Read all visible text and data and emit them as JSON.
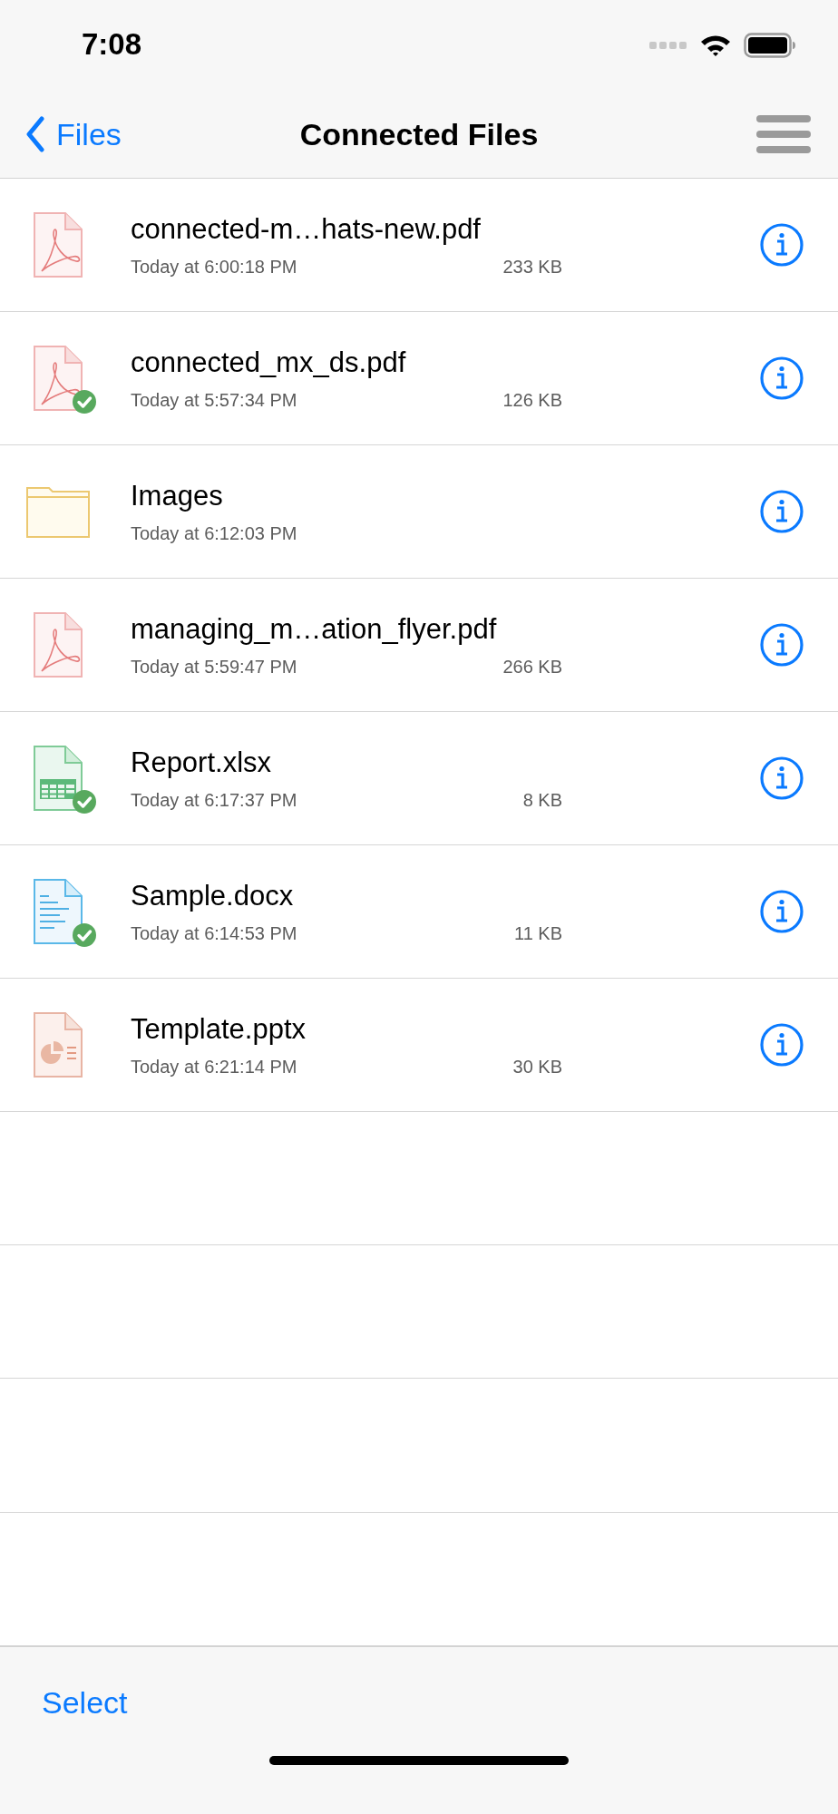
{
  "status_bar": {
    "time": "7:08"
  },
  "nav": {
    "back_label": "Files",
    "title": "Connected Files"
  },
  "files": [
    {
      "kind": "pdf",
      "name": "connected-m…hats-new.pdf",
      "modified": "Today at 6:00:18 PM",
      "size": "233 KB",
      "synced": false
    },
    {
      "kind": "pdf",
      "name": "connected_mx_ds.pdf",
      "modified": "Today at 5:57:34 PM",
      "size": "126 KB",
      "synced": true
    },
    {
      "kind": "folder",
      "name": "Images",
      "modified": "Today at 6:12:03 PM",
      "synced": false
    },
    {
      "kind": "pdf",
      "name": "managing_m…ation_flyer.pdf",
      "modified": "Today at 5:59:47 PM",
      "size": "266 KB",
      "synced": false
    },
    {
      "kind": "xlsx",
      "name": "Report.xlsx",
      "modified": "Today at 6:17:37 PM",
      "size": "8 KB",
      "synced": true
    },
    {
      "kind": "docx",
      "name": "Sample.docx",
      "modified": "Today at 6:14:53 PM",
      "size": "11 KB",
      "synced": true
    },
    {
      "kind": "pptx",
      "name": "Template.pptx",
      "modified": "Today at 6:21:14 PM",
      "size": "30 KB",
      "synced": false
    }
  ],
  "toolbar": {
    "select": "Select"
  }
}
